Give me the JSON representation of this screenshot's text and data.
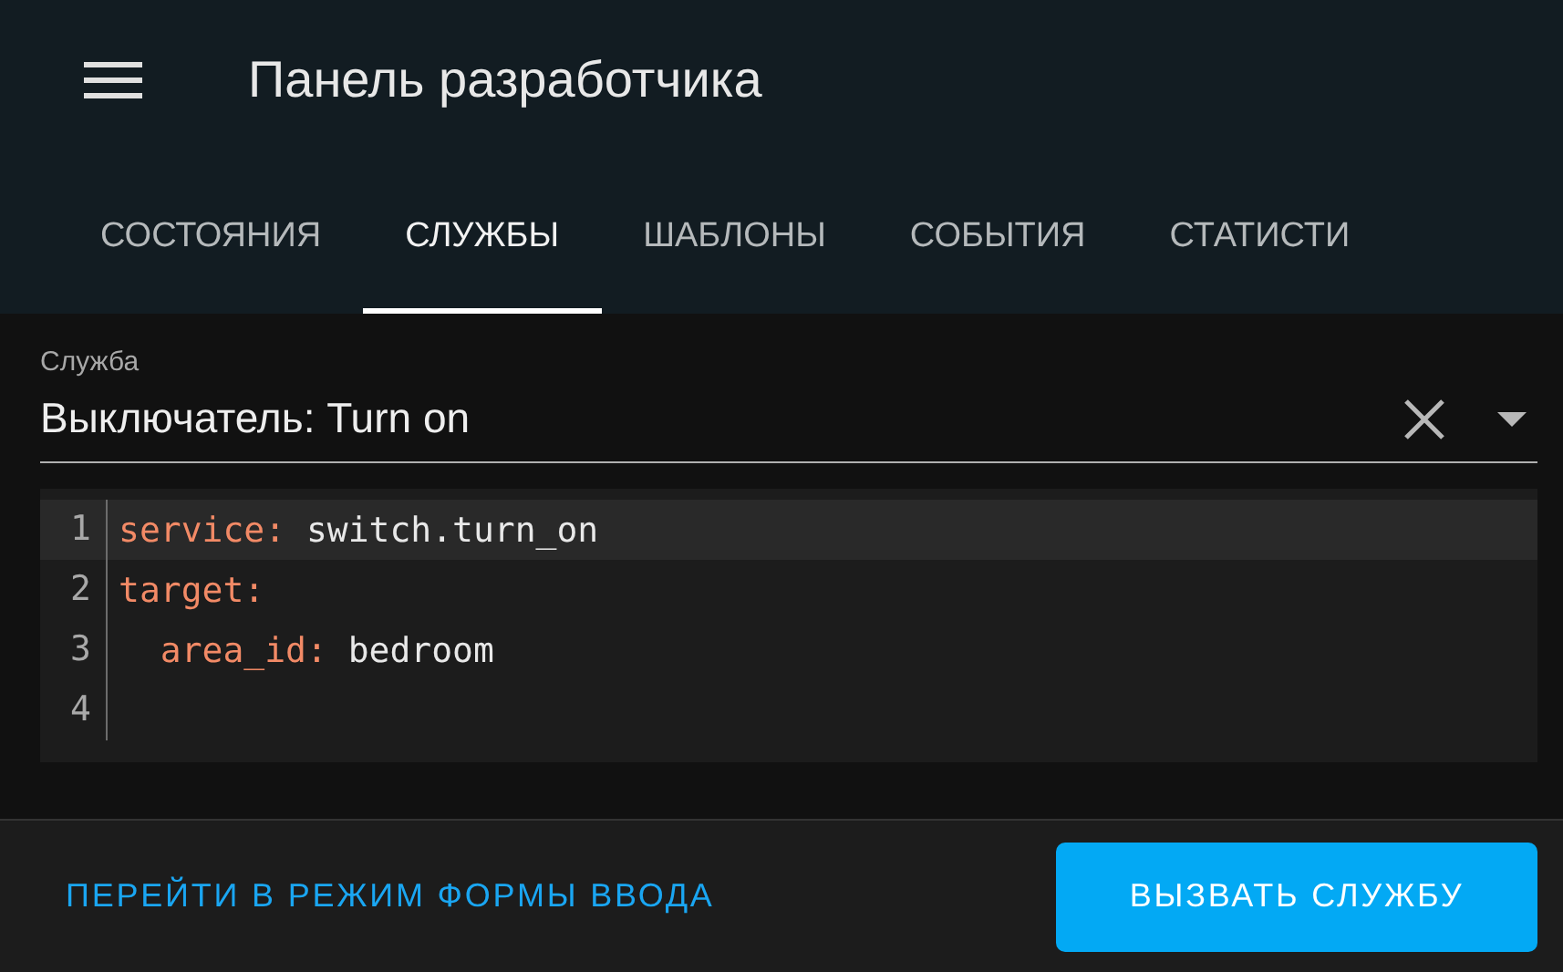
{
  "header": {
    "title": "Панель разработчика"
  },
  "tabs": [
    {
      "label": "СОСТОЯНИЯ",
      "selected": false
    },
    {
      "label": "СЛУЖБЫ",
      "selected": true
    },
    {
      "label": "ШАБЛОНЫ",
      "selected": false
    },
    {
      "label": "СОБЫТИЯ",
      "selected": false
    },
    {
      "label": "СТАТИСТИ",
      "selected": false
    }
  ],
  "service_field": {
    "label": "Служба",
    "value": "Выключатель: Turn on"
  },
  "editor": {
    "lines": [
      {
        "number": "1",
        "active": true,
        "tokens": [
          {
            "kind": "key",
            "text": "service"
          },
          {
            "kind": "punct",
            "text": ":"
          },
          {
            "kind": "value",
            "text": " switch.turn_on"
          }
        ]
      },
      {
        "number": "2",
        "active": false,
        "tokens": [
          {
            "kind": "key",
            "text": "target"
          },
          {
            "kind": "punct",
            "text": ":"
          }
        ]
      },
      {
        "number": "3",
        "active": false,
        "tokens": [
          {
            "kind": "key",
            "text": "  area_id"
          },
          {
            "kind": "punct",
            "text": ":"
          },
          {
            "kind": "value",
            "text": " bedroom"
          }
        ]
      },
      {
        "number": "4",
        "active": false
      }
    ]
  },
  "footer": {
    "mode_link": "ПЕРЕЙТИ В РЕЖИМ ФОРМЫ ВВОДА",
    "call_button": "ВЫЗВАТЬ СЛУЖБУ"
  }
}
